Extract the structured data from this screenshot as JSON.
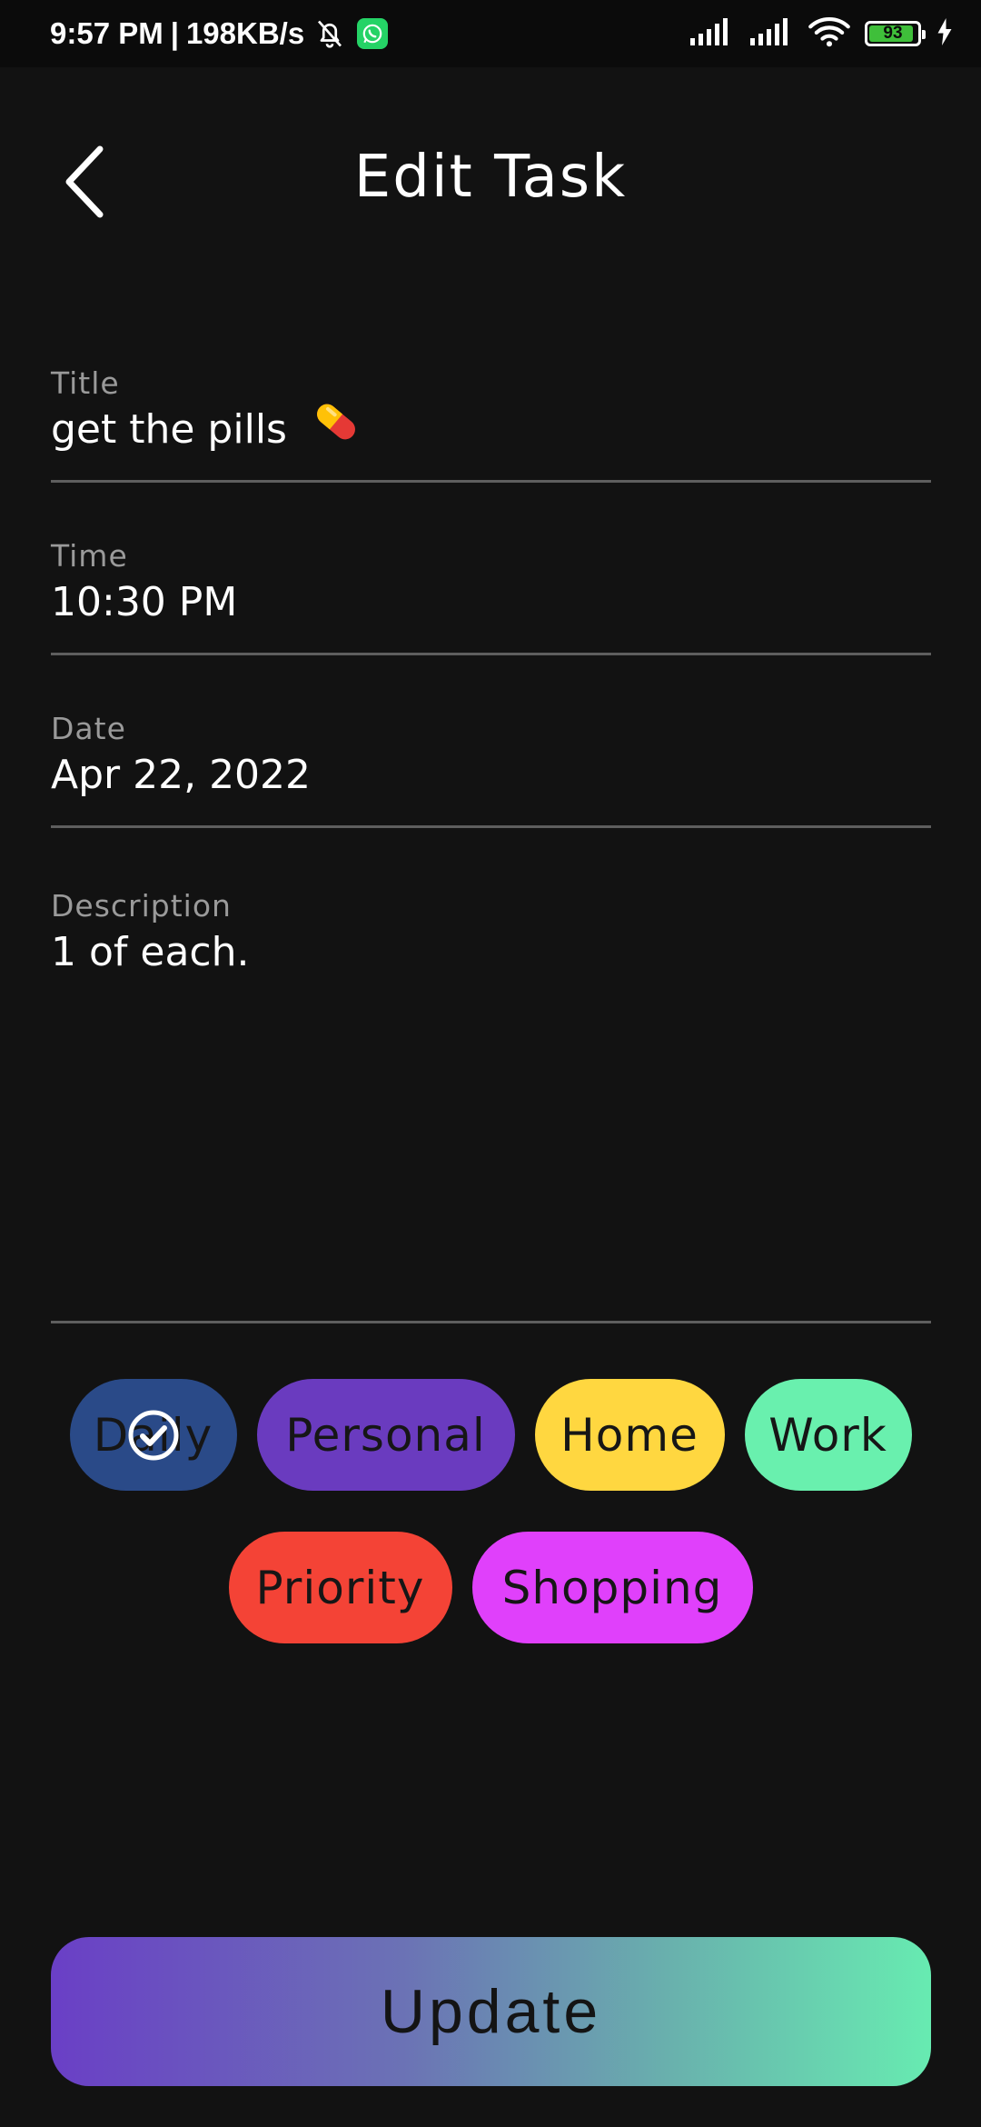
{
  "status_bar": {
    "time": "9:57 PM",
    "separator": "|",
    "net_speed": "198KB/s",
    "battery": "93",
    "battery_level": 0.93
  },
  "header": {
    "title": "Edit Task"
  },
  "fields": {
    "title": {
      "label": "Title",
      "value": "get the pills"
    },
    "time": {
      "label": "Time",
      "value": "10:30 PM"
    },
    "date": {
      "label": "Date",
      "value": "Apr 22, 2022"
    },
    "description": {
      "label": "Description",
      "value": "1 of each."
    }
  },
  "categories": {
    "row1": [
      {
        "label": "Daily",
        "color": "#2a4a88",
        "selected": true
      },
      {
        "label": "Personal",
        "color": "#6a3bbf",
        "selected": false
      },
      {
        "label": "Home",
        "color": "#ffd740",
        "selected": false
      },
      {
        "label": "Work",
        "color": "#69f0ae",
        "selected": false
      }
    ],
    "row2": [
      {
        "label": "Priority",
        "color": "#f44336",
        "selected": false
      },
      {
        "label": "Shopping",
        "color": "#e040fb",
        "selected": false
      }
    ]
  },
  "update_button": {
    "label": "Update"
  }
}
